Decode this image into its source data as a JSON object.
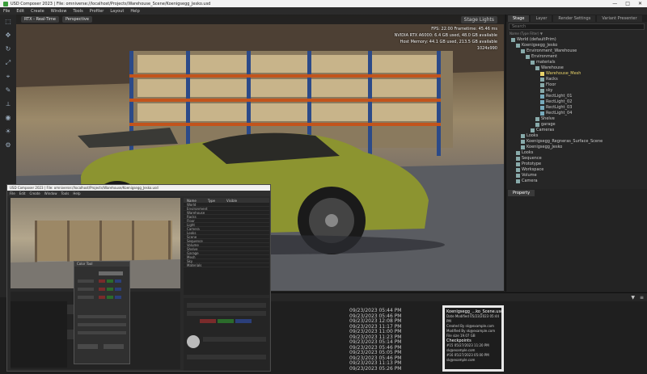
{
  "window": {
    "title": "USD Composer 2023 | File: omniverse://localhost/Projects/Warehouse_Scene/Koenigsegg_Jesko.usd",
    "controls": [
      "—",
      "□",
      "✕"
    ]
  },
  "menubar": {
    "items": [
      "File",
      "Edit",
      "Create",
      "Window",
      "Tools",
      "Profiler",
      "Layout",
      "Help"
    ]
  },
  "left_tools": [
    "select",
    "move",
    "rotate",
    "scale",
    "snap",
    "paint",
    "measure",
    "camera",
    "light",
    "physics"
  ],
  "viewport": {
    "renderer_chip": "RTX - Real-Time",
    "camera_chip": "Perspective",
    "stage_lights": "Stage Lights",
    "hud": [
      "FPS: 22.00 Frametime: 45.46 ms",
      "NVIDIA RTX A6000: 6.4 GB used, 48.0 GB available",
      "Host Memory: 44.1 GB used, 213.5 GB available",
      "1024x990"
    ]
  },
  "stage": {
    "tabs": [
      "Stage",
      "Layer",
      "Render Settings",
      "Variant Presenter"
    ],
    "active_tab": "Stage",
    "search_placeholder": "Search",
    "header": "Name (Type Filter) ▼",
    "tree": [
      {
        "label": "World (defaultPrim)",
        "indent": 1,
        "icon": "#8aa"
      },
      {
        "label": "Koenigsegg_Jesko",
        "indent": 2,
        "icon": "#8aa"
      },
      {
        "label": "Environment_Warehouse",
        "indent": 3,
        "icon": "#8aa"
      },
      {
        "label": "Environment",
        "indent": 4,
        "icon": "#8aa"
      },
      {
        "label": "materials",
        "indent": 5,
        "icon": "#8aa"
      },
      {
        "label": "Warehouse",
        "indent": 6,
        "icon": "#8aa"
      },
      {
        "label": "Warehouse_Mesh",
        "indent": 7,
        "icon": "#e8d36a",
        "hl": true
      },
      {
        "label": "Racks",
        "indent": 7,
        "icon": "#8aa"
      },
      {
        "label": "Floor",
        "indent": 7,
        "icon": "#8aa"
      },
      {
        "label": "sky",
        "indent": 7,
        "icon": "#8aa"
      },
      {
        "label": "RectLight_01",
        "indent": 7,
        "icon": "#7ab"
      },
      {
        "label": "RectLight_02",
        "indent": 7,
        "icon": "#7ab"
      },
      {
        "label": "RectLight_03",
        "indent": 7,
        "icon": "#7ab"
      },
      {
        "label": "RectLight_04",
        "indent": 7,
        "icon": "#7ab"
      },
      {
        "label": "Shelve",
        "indent": 6,
        "icon": "#8aa"
      },
      {
        "label": "garage",
        "indent": 6,
        "icon": "#8aa"
      },
      {
        "label": "Cameras",
        "indent": 5,
        "icon": "#8aa"
      },
      {
        "label": "Looks",
        "indent": 3,
        "icon": "#8aa"
      },
      {
        "label": "Koenigsegg_Regneras_Surface_Scene",
        "indent": 3,
        "icon": "#8aa"
      },
      {
        "label": "Koenigsegg_Jesko",
        "indent": 3,
        "icon": "#8aa"
      },
      {
        "label": "Looks",
        "indent": 2,
        "icon": "#8aa"
      },
      {
        "label": "Sequence",
        "indent": 2,
        "icon": "#8aa"
      },
      {
        "label": "Prototype",
        "indent": 2,
        "icon": "#8aa"
      },
      {
        "label": "Workspace",
        "indent": 2,
        "icon": "#8aa"
      },
      {
        "label": "Volume",
        "indent": 2,
        "icon": "#8aa"
      },
      {
        "label": "Camera",
        "indent": 2,
        "icon": "#8aa"
      }
    ]
  },
  "property": {
    "tab": "Property"
  },
  "bottom": {
    "dates": [
      "09/23/2023 05:44 PM",
      "09/23/2023 05:46 PM",
      "09/23/2023 12:08 PM",
      "09/23/2023 11:17 PM",
      "09/23/2023 11:00 PM",
      "09/23/2023 11:23 PM",
      "09/23/2023 05:14 PM",
      "09/23/2023 05:46 PM",
      "09/23/2023 05:05 PM",
      "09/23/2023 05:46 PM",
      "09/23/2023 11:13 PM",
      "09/23/2023 05:26 PM"
    ],
    "file_card": {
      "name": "Koenigsegg_...ko_Scene.usd",
      "lines": [
        "Date Modified 05/23/2023 05:44 PM",
        "Created By  sk@example.com",
        "Modified By  sk@example.com",
        "File size  19.07 GB"
      ],
      "checkpoints": "Checkpoints",
      "cp1": "#15  05/27/2023 11:20 PM",
      "cp1_by": "sk@example.com",
      "cp2": "#16  05/27/2023 05:00 PM",
      "cp2_by": "sk@example.com"
    }
  },
  "sub_window": {
    "title": "USD Composer 2023 | File: omniverse://localhost/Projects/Warehouse/Koenigsegg_Jesko.usd",
    "menu": [
      "File",
      "Edit",
      "Create",
      "Window",
      "Tools",
      "Help"
    ],
    "stage_rows": [
      "World",
      "Environment",
      "Warehouse",
      "Racks",
      "Floor",
      "Light",
      "Camera",
      "Looks",
      "Scene",
      "Sequence",
      "Volume",
      "Shelve",
      "Garage",
      "Mesh",
      "Sky",
      "Materials"
    ],
    "stage_hdr": [
      "Name",
      "Type",
      "Visible"
    ],
    "panel_title": "Color Tool"
  }
}
